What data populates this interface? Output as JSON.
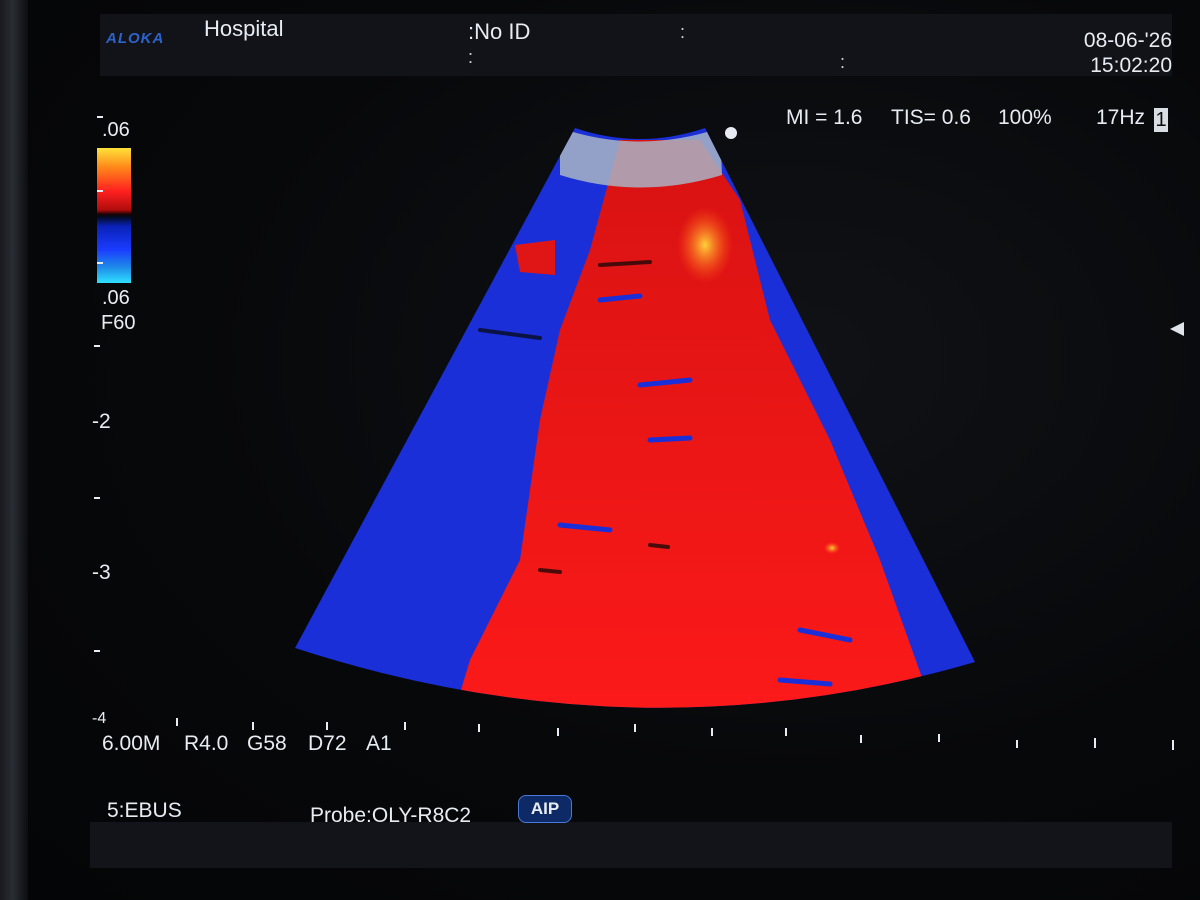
{
  "header": {
    "logo": "ALOKA",
    "hospital": "Hospital",
    "patient_id": ":No ID",
    "date": "08-06-'26",
    "time": "15:02:20"
  },
  "params": {
    "mi": "MI = 1.6",
    "tis": "TIS= 0.6",
    "power": "100%",
    "frame_rate": "17Hz",
    "frame_index": "1"
  },
  "color_scale": {
    "top": ".06",
    "bottom": ".06",
    "filter": "F60",
    "colors": [
      "#ffe23a",
      "#ff2020",
      "#1a3bff",
      "#2ee0ff"
    ]
  },
  "depth_scale": {
    "labels": [
      "-2",
      "-3",
      "-4"
    ]
  },
  "image_params": {
    "range": "6.00M",
    "r": "R4.0",
    "gain": "G58",
    "dynamic": "D72",
    "a": "A1"
  },
  "footer": {
    "preset": "5:EBUS",
    "probe": "Probe:OLY-R8C2",
    "badge": "AIP"
  },
  "colors": {
    "doppler_red": "#ff1a1a",
    "doppler_blue": "#1a2fd8",
    "logo_blue": "#2d63c9"
  }
}
